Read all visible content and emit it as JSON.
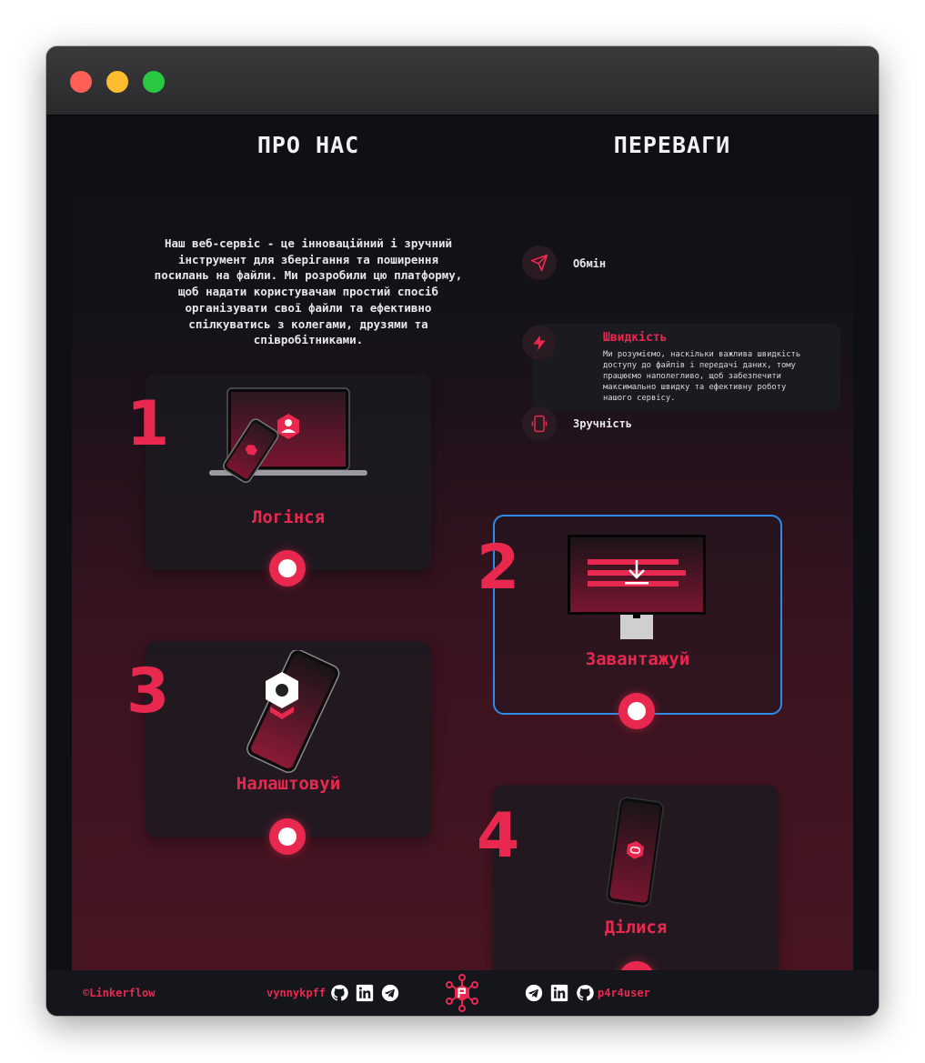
{
  "about": {
    "title": "ПРО НАС",
    "lines": [
      "Наш веб-сервіс - це інноваційний і зручний",
      "інструмент для зберігання та  поширення",
      "посилань на файли. Ми розробили цю платформу,",
      "щоб надати користувачам простий спосіб",
      "організувати свої файли та ефективно",
      "спілкуватись з колегами, друзями та",
      "співробітниками."
    ]
  },
  "advantages": {
    "title": "ПЕРЕВАГИ",
    "items": [
      {
        "label": "Обмін",
        "icon": "send-icon"
      },
      {
        "label": "Швидкість",
        "icon": "lightning-icon",
        "description_lines": [
          "Ми розуміємо, наскільки важлива швидкість",
          "доступу до файлів і передачі даних, тому",
          "працюємо наполегливо, щоб забезпечити",
          "максимально швидку та ефективну роботу",
          "нашого сервісу."
        ]
      },
      {
        "label": "Зручність",
        "icon": "phone-icon"
      }
    ]
  },
  "steps": [
    {
      "number": "1",
      "label": "Логінся"
    },
    {
      "number": "2",
      "label": "Завантажуй"
    },
    {
      "number": "3",
      "label": "Налаштовуй"
    },
    {
      "number": "4",
      "label": "Ділися"
    }
  ],
  "footer": {
    "copyright": "©Linkerflow",
    "left_user": "vynnykpff",
    "right_user": "p4r4user",
    "icons": [
      "github-icon",
      "linkedin-icon",
      "telegram-icon"
    ]
  },
  "colors": {
    "accent": "#e8284e",
    "active_outline": "#2d8ceb",
    "background": "#0e1016"
  }
}
